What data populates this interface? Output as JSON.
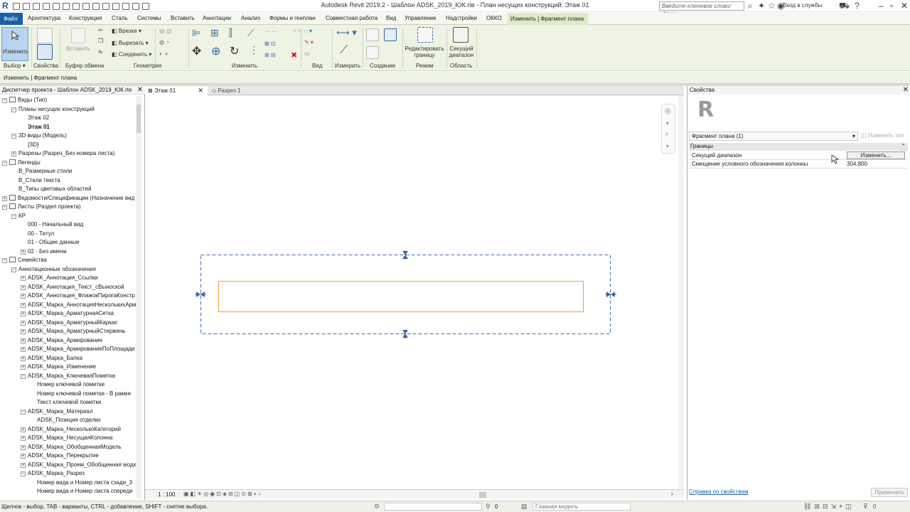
{
  "window": {
    "title": "Autodesk Revit 2019.2 - Шаблон ADSK_2019_ЮК.rte - План несущих конструкций: Этаж 01",
    "search_placeholder": "Введите ключевое слово/фразу",
    "login": "Вход в службы"
  },
  "ribbon_tabs": [
    "Файл",
    "Архитектура",
    "Конструкция",
    "Сталь",
    "Системы",
    "Вставить",
    "Аннотации",
    "Анализ",
    "Формы и генплан",
    "Совместная работа",
    "Вид",
    "Управление",
    "Надстройки",
    "ОККО",
    "Изменить | Фрагмент плана"
  ],
  "ribbon": {
    "modify_label": "Изменить",
    "paste_label": "Вставить",
    "cut_label": "Врезка",
    "cut_label2": "Вырезать",
    "join_label": "Соединить",
    "edit_boundary": "Редактировать границу",
    "section_range": "Секущий диапазон",
    "panels": [
      "Выбор",
      "Свойства",
      "Буфер обмена",
      "Геометрия",
      "Изменить",
      "Вид",
      "Измерить",
      "Создание",
      "Режим",
      "Область"
    ]
  },
  "context_label": "Изменить | Фрагмент плана",
  "browser": {
    "title": "Диспетчер проекта - Шаблон ADSK_2019_ЮК.rte",
    "items": [
      {
        "label": "Виды (Тип)",
        "level": 0,
        "toggle": "−",
        "icon": true
      },
      {
        "label": "Планы несущих конструкций",
        "level": 1,
        "toggle": "−"
      },
      {
        "label": "Этаж 02",
        "level": 2
      },
      {
        "label": "Этаж 01",
        "level": 2,
        "bold": true
      },
      {
        "label": "3D виды (Модель)",
        "level": 1,
        "toggle": "−"
      },
      {
        "label": "{3D}",
        "level": 2
      },
      {
        "label": "Разрезы (Разрез_Без номера листа)",
        "level": 1,
        "toggle": "+"
      },
      {
        "label": "Легенды",
        "level": 0,
        "toggle": "−",
        "icon": true
      },
      {
        "label": "В_Размерные стили",
        "level": 1
      },
      {
        "label": "В_Стили текста",
        "level": 1
      },
      {
        "label": "В_Типы цветовых областей",
        "level": 1
      },
      {
        "label": "Ведомости/Спецификации (Назначение вид",
        "level": 0,
        "toggle": "+",
        "icon": true
      },
      {
        "label": "Листы (Раздел проекта)",
        "level": 0,
        "toggle": "−",
        "icon": true
      },
      {
        "label": "КР",
        "level": 1,
        "toggle": "−"
      },
      {
        "label": "000 - Начальный вид",
        "level": 2
      },
      {
        "label": "00 - Титул",
        "level": 2
      },
      {
        "label": "01 - Общие данные",
        "level": 2
      },
      {
        "label": "02 - Без имени",
        "level": 2,
        "toggle": "+"
      },
      {
        "label": "Семейства",
        "level": 0,
        "toggle": "−",
        "icon": true
      },
      {
        "label": "Аннотационные обозначения",
        "level": 1,
        "toggle": "−"
      },
      {
        "label": "ADSK_Аннотация_Ссылки",
        "level": 2,
        "toggle": "+"
      },
      {
        "label": "ADSK_Аннотация_Текст_сВыноской",
        "level": 2,
        "toggle": "+"
      },
      {
        "label": "ADSK_Аннотация_ФлажокПирогаКонстр",
        "level": 2,
        "toggle": "+"
      },
      {
        "label": "ADSK_Марка_АннотацияНесколькихАрм",
        "level": 2,
        "toggle": "+"
      },
      {
        "label": "ADSK_Марка_АрматурнаяСетка",
        "level": 2,
        "toggle": "+"
      },
      {
        "label": "ADSK_Марка_АрматурныйКаркас",
        "level": 2,
        "toggle": "+"
      },
      {
        "label": "ADSK_Марка_АрматурныйСтержень",
        "level": 2,
        "toggle": "+"
      },
      {
        "label": "ADSK_Марка_Армирование",
        "level": 2,
        "toggle": "+"
      },
      {
        "label": "ADSK_Марка_АрмированиеПоПлощади",
        "level": 2,
        "toggle": "+"
      },
      {
        "label": "ADSK_Марка_Балка",
        "level": 2,
        "toggle": "+"
      },
      {
        "label": "ADSK_Марка_Изменение",
        "level": 2,
        "toggle": "+"
      },
      {
        "label": "ADSK_Марка_КлючеваяПометка",
        "level": 2,
        "toggle": "−"
      },
      {
        "label": "Номер ключевой пометки",
        "level": 3
      },
      {
        "label": "Номер ключевой пометки - В рамке",
        "level": 3
      },
      {
        "label": "Текст ключевой пометки",
        "level": 3
      },
      {
        "label": "ADSK_Марка_Материал",
        "level": 2,
        "toggle": "−"
      },
      {
        "label": "ADSK_Позиция отделки",
        "level": 3
      },
      {
        "label": "ADSK_Марка_НесколькоКатегорий",
        "level": 2,
        "toggle": "+"
      },
      {
        "label": "ADSK_Марка_НесущаяКолонна",
        "level": 2,
        "toggle": "+"
      },
      {
        "label": "ADSK_Марка_ОбобщеннаяМодель",
        "level": 2,
        "toggle": "+"
      },
      {
        "label": "ADSK_Марка_Перекрытие",
        "level": 2,
        "toggle": "+"
      },
      {
        "label": "ADSK_Марка_Проем_Обобщенная моде",
        "level": 2,
        "toggle": "+"
      },
      {
        "label": "ADSK_Марка_Разрез",
        "level": 2,
        "toggle": "−"
      },
      {
        "label": "Номер вида и Номер листа сзади_3",
        "level": 3
      },
      {
        "label": "Номер вида и Номер листа спереди",
        "level": 3
      }
    ]
  },
  "view_tabs": [
    "Этаж 01",
    "Разрез 1"
  ],
  "view_scale": "1 : 100",
  "properties": {
    "title": "Свойства",
    "type_selector": "Фрагмент плана (1)",
    "edit_type": "Изменить тип",
    "group": "Границы",
    "rows": [
      {
        "name": "Секущий диапазон",
        "value": "Изменить..."
      },
      {
        "name": "Смещение условного обозначения колонны",
        "value": "304,800"
      }
    ],
    "help_link": "Справка по свойствам",
    "apply": "Применить"
  },
  "status": {
    "text": "Щелчок - выбор, TAB - варианты, CTRL - добавление, SHIFT - снятие выбора.",
    "selected_count": "0",
    "model": "Главная модель"
  },
  "colors": {
    "accent": "#1a5fa8",
    "ribbon_bg": "#eef3e3",
    "boundary_dash": "#4a6fa8",
    "region_orange": "#f0a030"
  }
}
